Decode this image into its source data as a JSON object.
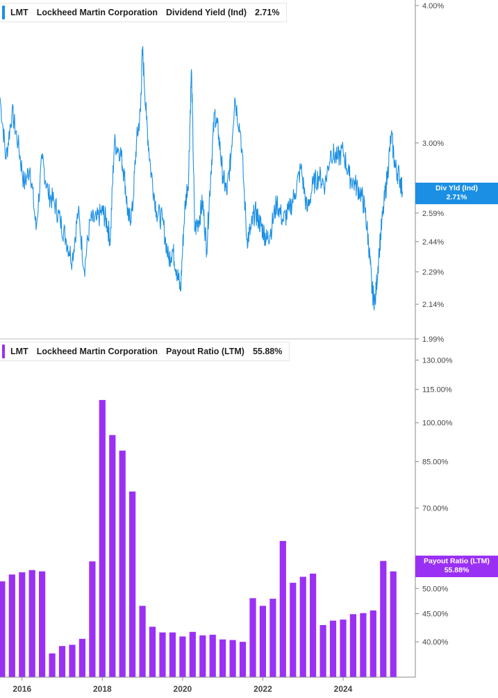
{
  "colors": {
    "yield": "#1a8fe3",
    "payout": "#9b30f5",
    "axis": "#888888",
    "text": "#444444"
  },
  "top_panel": {
    "legend": {
      "ticker": "LMT",
      "company": "Lockheed Martin Corporation",
      "metric": "Dividend Yield (Ind)",
      "value": "2.71%"
    },
    "tag": {
      "label": "Div Yld (Ind)",
      "value": "2.71%"
    }
  },
  "bottom_panel": {
    "legend": {
      "ticker": "LMT",
      "company": "Lockheed Martin Corporation",
      "metric": "Payout Ratio (LTM)",
      "value": "55.88%"
    },
    "tag": {
      "label": "Payout Ratio (LTM)",
      "value": "55.88%"
    }
  },
  "chart_data": [
    {
      "type": "line",
      "title": "LMT Lockheed Martin Corporation Dividend Yield (Ind)",
      "scale": "log",
      "ylim": [
        1.99,
        4.0
      ],
      "y_ticks": [
        "4.00%",
        "3.00%",
        "2.59%",
        "2.44%",
        "2.29%",
        "2.14%",
        "1.99%"
      ],
      "y_tick_values": [
        4.0,
        3.0,
        2.59,
        2.44,
        2.29,
        2.14,
        1.99
      ],
      "x_ticks": [
        "2016",
        "2018",
        "2020",
        "2022",
        "2024"
      ],
      "x_tick_values": [
        2016,
        2018,
        2020,
        2022,
        2024
      ],
      "xlim": [
        2015.45,
        2025.8
      ],
      "series": [
        {
          "name": "Dividend Yield (Ind)",
          "x": [
            2015.45,
            2015.6,
            2015.75,
            2015.9,
            2016.05,
            2016.2,
            2016.35,
            2016.5,
            2016.65,
            2016.8,
            2016.95,
            2017.1,
            2017.25,
            2017.4,
            2017.55,
            2017.7,
            2017.85,
            2018.0,
            2018.1,
            2018.2,
            2018.3,
            2018.45,
            2018.55,
            2018.65,
            2018.75,
            2018.85,
            2018.95,
            2019.0,
            2019.1,
            2019.2,
            2019.35,
            2019.5,
            2019.65,
            2019.75,
            2019.85,
            2019.95,
            2020.05,
            2020.15,
            2020.22,
            2020.3,
            2020.4,
            2020.5,
            2020.6,
            2020.7,
            2020.8,
            2020.9,
            2021.0,
            2021.1,
            2021.2,
            2021.3,
            2021.45,
            2021.6,
            2021.7,
            2021.8,
            2021.9,
            2022.0,
            2022.1,
            2022.2,
            2022.35,
            2022.5,
            2022.65,
            2022.8,
            2022.95,
            2023.1,
            2023.25,
            2023.4,
            2023.55,
            2023.7,
            2023.85,
            2024.0,
            2024.15,
            2024.3,
            2024.45,
            2024.55,
            2024.65,
            2024.72,
            2024.8,
            2024.9,
            2025.0,
            2025.1,
            2025.2,
            2025.3,
            2025.4,
            2025.48
          ],
          "values": [
            3.3,
            2.9,
            3.2,
            3.0,
            2.75,
            2.85,
            2.5,
            2.9,
            2.7,
            2.65,
            2.55,
            2.45,
            2.35,
            2.6,
            2.3,
            2.55,
            2.55,
            2.6,
            2.55,
            2.45,
            3.0,
            2.95,
            2.8,
            2.55,
            2.6,
            3.0,
            3.2,
            3.65,
            3.15,
            2.85,
            2.6,
            2.55,
            2.35,
            2.4,
            2.3,
            2.2,
            2.6,
            2.8,
            3.5,
            2.5,
            2.55,
            2.65,
            2.4,
            2.8,
            3.2,
            3.05,
            2.8,
            2.7,
            2.9,
            3.3,
            3.05,
            2.45,
            2.5,
            2.6,
            2.55,
            2.5,
            2.45,
            2.5,
            2.65,
            2.55,
            2.6,
            2.7,
            2.85,
            2.6,
            2.75,
            2.8,
            2.75,
            2.95,
            2.9,
            2.95,
            2.8,
            2.75,
            2.7,
            2.6,
            2.4,
            2.2,
            2.15,
            2.4,
            2.6,
            2.8,
            3.05,
            2.85,
            2.8,
            2.71
          ]
        }
      ]
    },
    {
      "type": "bar",
      "title": "LMT Lockheed Martin Corporation Payout Ratio (LTM)",
      "scale": "log",
      "ylim": [
        34.5,
        134.0
      ],
      "y_ticks": [
        "130.00%",
        "115.00%",
        "100.00%",
        "85.00%",
        "70.00%",
        "55.00%",
        "50.00%",
        "45.00%",
        "40.00%"
      ],
      "y_tick_values": [
        130,
        115,
        100,
        85,
        70,
        55,
        50,
        45,
        40
      ],
      "x_ticks": [
        "2016",
        "2018",
        "2020",
        "2022",
        "2024"
      ],
      "x_tick_values": [
        2016,
        2018,
        2020,
        2022,
        2024
      ],
      "xlim": [
        2015.45,
        2025.8
      ],
      "bar_width_years": 0.16,
      "series": [
        {
          "name": "Payout Ratio (LTM)",
          "x": [
            2015.5,
            2015.75,
            2016.0,
            2016.25,
            2016.5,
            2016.75,
            2017.0,
            2017.25,
            2017.5,
            2017.75,
            2018.0,
            2018.25,
            2018.5,
            2018.75,
            2019.0,
            2019.25,
            2019.5,
            2019.75,
            2020.0,
            2020.25,
            2020.5,
            2020.75,
            2021.0,
            2021.25,
            2021.5,
            2021.75,
            2022.0,
            2022.25,
            2022.5,
            2022.75,
            2023.0,
            2023.25,
            2023.5,
            2023.75,
            2024.0,
            2024.25,
            2024.5,
            2024.75,
            2025.0,
            2025.25
          ],
          "values": [
            51.5,
            53.0,
            53.5,
            54.0,
            53.7,
            38.1,
            39.3,
            39.5,
            40.5,
            56.0,
            110.0,
            95.0,
            89.0,
            75.0,
            46.5,
            42.6,
            41.6,
            41.6,
            40.9,
            41.7,
            41.1,
            41.2,
            40.4,
            40.3,
            40.0,
            48.0,
            46.5,
            47.9,
            61.0,
            51.2,
            52.5,
            53.2,
            42.9,
            43.7,
            43.9,
            44.9,
            45.1,
            45.6,
            56.1,
            53.7
          ]
        }
      ]
    }
  ]
}
